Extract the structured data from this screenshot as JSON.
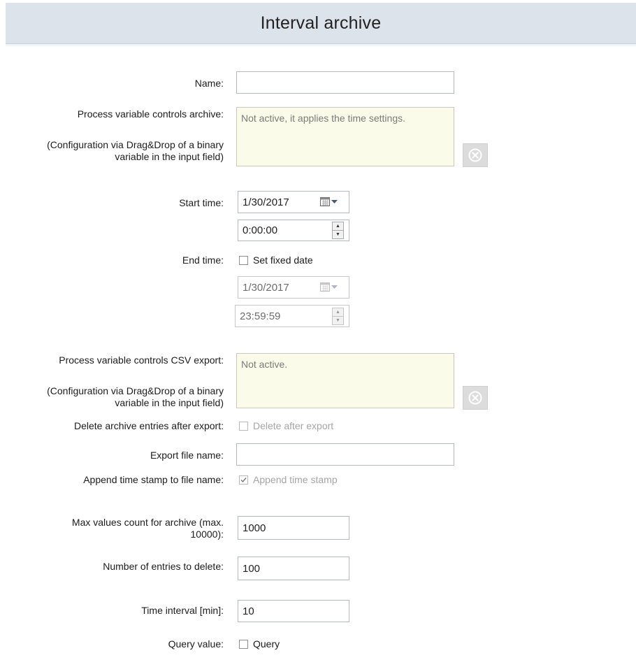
{
  "header": {
    "title": "Interval archive"
  },
  "name": {
    "label": "Name:",
    "value": ""
  },
  "archive_control": {
    "label": "Process variable controls archive:",
    "hint": "(Configuration via Drag&Drop of a binary variable in the input field)",
    "value": "Not active, it applies the time settings."
  },
  "start_time": {
    "label": "Start time:",
    "date": "1/30/2017",
    "time": "0:00:00"
  },
  "end_time": {
    "label": "End time:",
    "fixed_date_label": "Set fixed date",
    "fixed_date_checked": false,
    "date": "1/30/2017",
    "time": "23:59:59"
  },
  "csv_control": {
    "label": "Process variable controls CSV export:",
    "hint": "(Configuration via Drag&Drop of a binary variable in the input field)",
    "value": "Not active."
  },
  "delete_entries": {
    "label": "Delete archive entries after export:",
    "checkbox_label": "Delete after export",
    "checked": false
  },
  "export_file": {
    "label": "Export file name:",
    "value": ""
  },
  "append_timestamp": {
    "label": "Append time stamp to file name:",
    "checkbox_label": "Append time stamp",
    "checked": true
  },
  "max_values": {
    "label": "Max values count for archive (max. 10000):",
    "value": "1000"
  },
  "entries_delete": {
    "label": "Number of entries to delete:",
    "value": "100"
  },
  "time_interval": {
    "label": "Time interval [min]:",
    "value": "10"
  },
  "query": {
    "label": "Query value:",
    "checkbox_label": "Query",
    "checked": false
  },
  "icons": [
    "calendar-icon",
    "dropdown-arrow-icon",
    "spin-up-icon",
    "spin-down-icon",
    "clear-icon",
    "checkmark-icon"
  ],
  "colors": {
    "header_bg": "#dce3ea",
    "note_bg": "#fbfbe9",
    "clear_button_bg": "#dcdcdc"
  }
}
